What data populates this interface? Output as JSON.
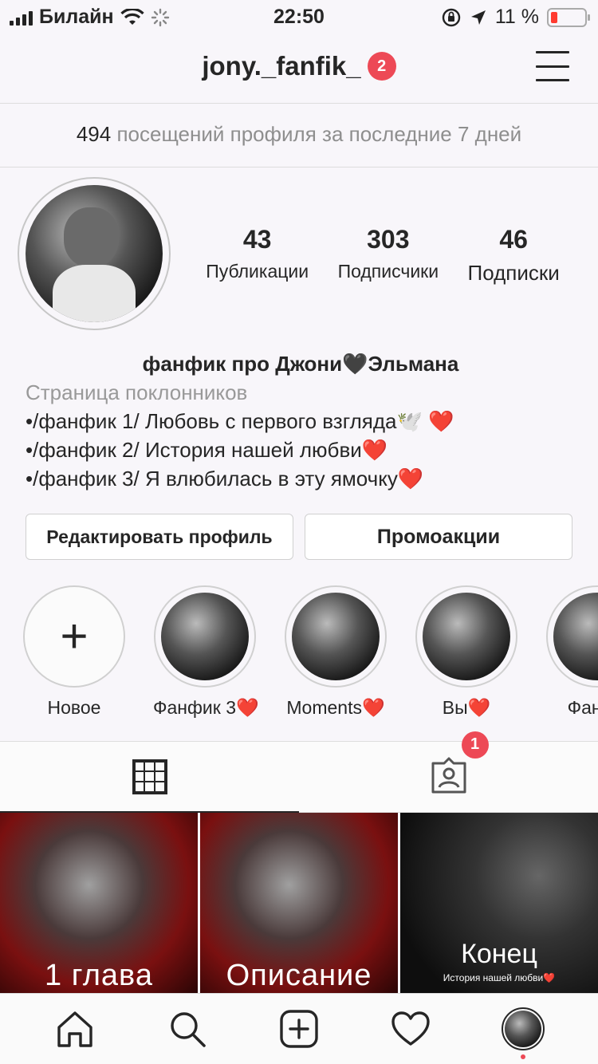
{
  "status_bar": {
    "carrier": "Билайн",
    "time": "22:50",
    "battery": "11 %",
    "battery_level": 0.11
  },
  "header": {
    "username": "jony._fanfik_",
    "notification_count": "2"
  },
  "visits": {
    "count": "494",
    "text": "посещений профиля за последние 7 дней"
  },
  "stats": {
    "posts": {
      "value": "43",
      "label": "Публикации"
    },
    "followers": {
      "value": "303",
      "label": "Подписчики"
    },
    "following": {
      "value": "46",
      "label": "Подписки"
    }
  },
  "bio": {
    "name": "фанфик про Джони🖤Эльмана",
    "category": "Страница поклонников",
    "lines": [
      "•/фанфик 1/ Любовь с первого взгляда🕊️ ❤️",
      "•/фанфик 2/ История нашей любви❤️",
      "•/фанфик 3/ Я влюбилась в эту ямочку❤️"
    ]
  },
  "buttons": {
    "edit_profile": "Редактировать профиль",
    "promotions": "Промоакции"
  },
  "highlights": {
    "new_symbol": "+",
    "items": [
      {
        "label": "Новое"
      },
      {
        "label": "Фанфик 3❤️"
      },
      {
        "label": "Moments❤️"
      },
      {
        "label": "Вы❤️"
      },
      {
        "label": "Фанфи"
      }
    ]
  },
  "tabs": {
    "tagged_badge": "1"
  },
  "posts": [
    {
      "caption": "1 глава"
    },
    {
      "caption": "Описание"
    },
    {
      "title": "Конец",
      "subtitle": "История нашей любви❤️"
    }
  ],
  "colors": {
    "accent_red": "#ed4956",
    "text": "#262626",
    "muted": "#8e8e8e",
    "background": "#f8f6fa"
  },
  "icons": {
    "nav": [
      "home-icon",
      "search-icon",
      "add-post-icon",
      "heart-icon",
      "profile-avatar"
    ],
    "tabs": [
      "grid-icon",
      "tagged-icon"
    ]
  }
}
